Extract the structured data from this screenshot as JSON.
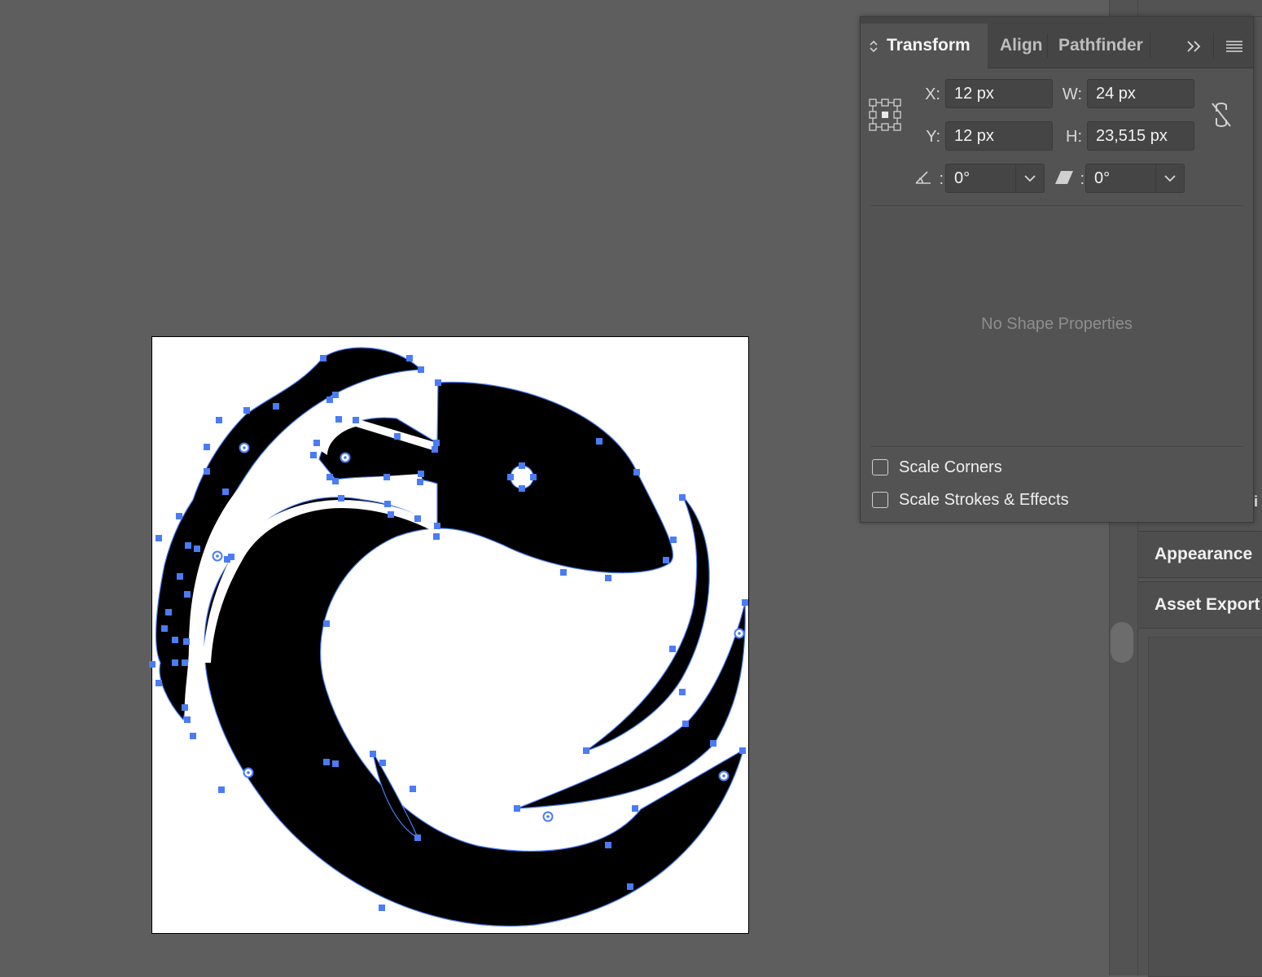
{
  "transform_panel": {
    "tabs": [
      {
        "label": "Transform",
        "active": true
      },
      {
        "label": "Align",
        "active": false
      },
      {
        "label": "Pathfinder",
        "active": false
      }
    ],
    "overflow_icon": "double-chevron-right-icon",
    "menu_icon": "hamburger-menu-icon",
    "reference_point_icon": "reference-point-grid-icon",
    "x": {
      "label": "X:",
      "value": "12 px"
    },
    "y": {
      "label": "Y:",
      "value": "12 px"
    },
    "w": {
      "label": "W:",
      "value": "24 px"
    },
    "h": {
      "label": "H:",
      "value": "23,515 px"
    },
    "constrain_icon": "unlinked-constrain-proportions-icon",
    "rotate": {
      "icon": "rotate-angle-icon",
      "value": "0°",
      "colon": ":"
    },
    "shear": {
      "icon": "shear-icon",
      "value": "0°",
      "colon": ":"
    },
    "empty_message": "No Shape Properties",
    "scale_corners": {
      "label": "Scale Corners",
      "checked": false
    },
    "scale_strokes": {
      "label": "Scale Strokes & Effects",
      "checked": false
    }
  },
  "dock": {
    "appearance_label": "Appearance",
    "asset_export_label": "Asset Export"
  },
  "canvas": {
    "artboard_color": "#ffffff",
    "shape_fill": "#000000",
    "selection_color": "#4a7cf5"
  }
}
